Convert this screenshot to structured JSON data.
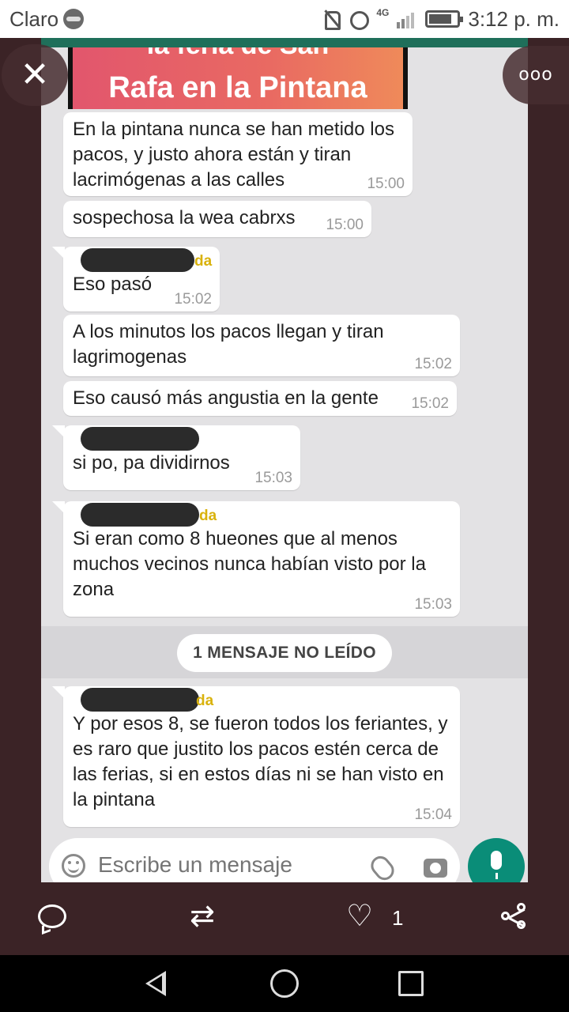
{
  "status_bar": {
    "carrier": "Claro",
    "network": "4G",
    "time": "3:12 p. m."
  },
  "image_preview": {
    "line1": "la feria de San",
    "line2": "Rafa en la Pintana"
  },
  "messages": [
    {
      "sender_suffix": "",
      "text": "En la pintana nunca se han metido los pacos, y justo ahora están y tiran lacrimógenas a las calles",
      "time": "15:00"
    },
    {
      "sender_suffix": "",
      "text": "sospechosa la wea cabrxs",
      "time": "15:00"
    },
    {
      "sender_suffix": "da",
      "text": "Eso pasó",
      "time": "15:02"
    },
    {
      "sender_suffix": "",
      "text": "A los minutos los pacos llegan y tiran lagrimogenas",
      "time": "15:02"
    },
    {
      "sender_suffix": "",
      "text": "Eso causó más angustia en la gente",
      "time": "15:02"
    },
    {
      "sender_suffix": "",
      "text": "si po, pa dividirnos",
      "time": "15:03"
    },
    {
      "sender_suffix": "da",
      "text": "Si eran como 8 hueones que al menos muchos vecinos nunca habían visto por la zona",
      "time": "15:03"
    },
    {
      "sender_suffix": "da",
      "text": "Y por esos 8, se fueron todos los feriantes, y es raro que justito los pacos estén cerca de las ferias, si en estos días ni se han visto en la pintana",
      "time": "15:04"
    }
  ],
  "unread_label": "1 MENSAJE NO LEÍDO",
  "input": {
    "placeholder": "Escribe un mensaje"
  },
  "viewer": {
    "close": "✕",
    "more": "ooo"
  },
  "post_actions": {
    "like_count": "1"
  },
  "icons": [
    "globe-icon",
    "mute-icon",
    "alarm-icon",
    "signal-icon",
    "battery-icon",
    "emoji-icon",
    "clip-icon",
    "camera-icon",
    "mic-icon",
    "comment-icon",
    "repost-icon",
    "heart-icon",
    "share-icon",
    "back-icon",
    "home-icon",
    "recents-icon"
  ],
  "colors": {
    "accent_green": "#0a8d78",
    "sender_yellow": "#d9b20c",
    "frame": "#3b2326"
  }
}
